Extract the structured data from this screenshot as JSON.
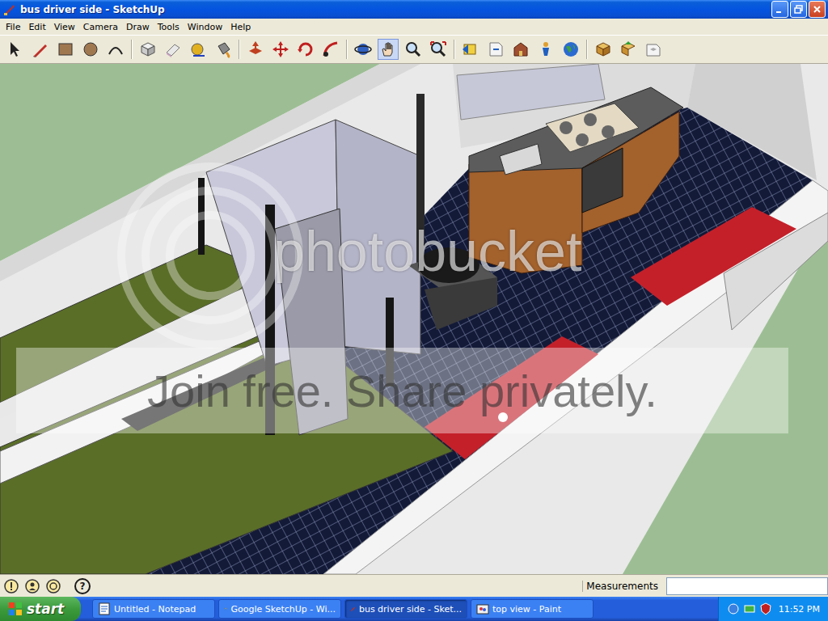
{
  "window": {
    "title": "bus driver side - SketchUp"
  },
  "menu": [
    "File",
    "Edit",
    "View",
    "Camera",
    "Draw",
    "Tools",
    "Window",
    "Help"
  ],
  "toolbar": {
    "groups": [
      [
        {
          "kind": "select",
          "selected": false
        },
        {
          "kind": "pencil",
          "selected": false
        },
        {
          "kind": "rectangle",
          "selected": false
        },
        {
          "kind": "circle",
          "selected": false
        },
        {
          "kind": "arc",
          "selected": false
        }
      ],
      [
        {
          "kind": "component",
          "selected": false
        },
        {
          "kind": "eraser",
          "selected": false
        },
        {
          "kind": "tape",
          "selected": false
        },
        {
          "kind": "paint",
          "selected": false
        }
      ],
      [
        {
          "kind": "pushpull",
          "selected": false
        },
        {
          "kind": "move",
          "selected": false
        },
        {
          "kind": "rotate",
          "selected": false
        },
        {
          "kind": "followme",
          "selected": false
        }
      ],
      [
        {
          "kind": "orbit",
          "selected": false
        },
        {
          "kind": "pan",
          "selected": true
        },
        {
          "kind": "zoom",
          "selected": false
        },
        {
          "kind": "zoomextents",
          "selected": false
        }
      ],
      [
        {
          "kind": "previous",
          "selected": false
        },
        {
          "kind": "next",
          "selected": false
        },
        {
          "kind": "warehouse",
          "selected": false
        },
        {
          "kind": "location",
          "selected": false
        },
        {
          "kind": "earth",
          "selected": false
        }
      ],
      [
        {
          "kind": "getmodels",
          "selected": false
        },
        {
          "kind": "share",
          "selected": false
        },
        {
          "kind": "place",
          "selected": false
        }
      ]
    ]
  },
  "watermark": {
    "logo": "photobucket",
    "banner": "Join free. Share privately."
  },
  "status_bar": {
    "help_icon": "?",
    "measurements_label": "Measurements"
  },
  "taskbar": {
    "start": "start",
    "items": [
      {
        "label": "Untitled - Notepad",
        "selected": false
      },
      {
        "label": "Google SketchUp - Wi...",
        "selected": false
      },
      {
        "label": "bus driver side - Sket...",
        "selected": true
      },
      {
        "label": "top view - Paint",
        "selected": false
      }
    ],
    "time": "11:52 PM"
  }
}
